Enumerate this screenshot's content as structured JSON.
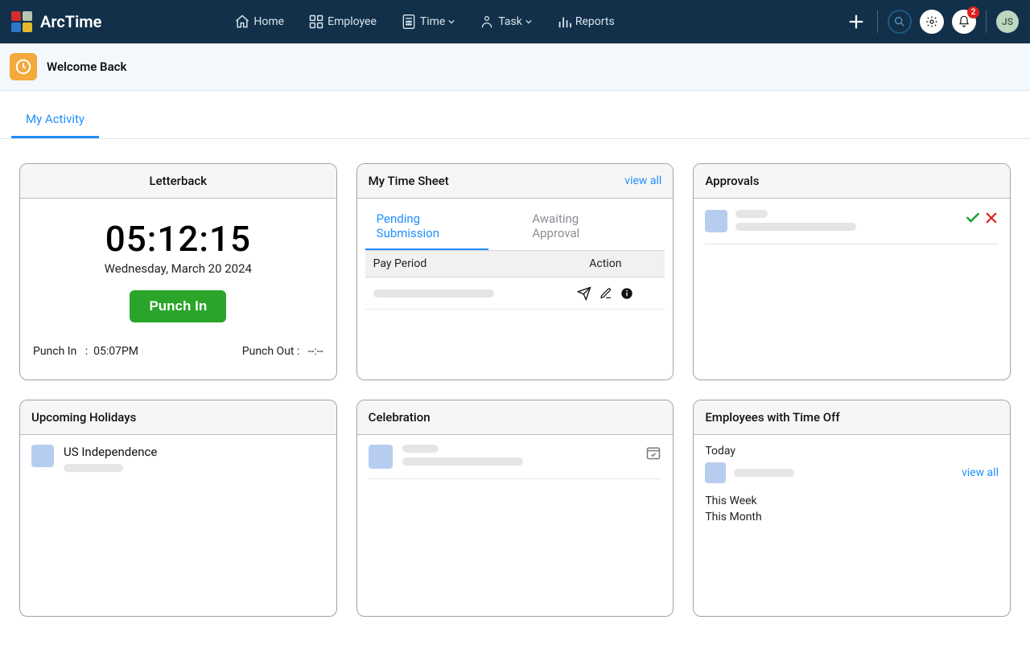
{
  "brand": {
    "name": "ArcTime"
  },
  "logo_colors": [
    "#d22c2c",
    "#b5c6b2",
    "#2d76c8",
    "#e2b92a"
  ],
  "nav": {
    "items": [
      {
        "label": "Home",
        "icon": "home"
      },
      {
        "label": "Employee",
        "icon": "grid"
      },
      {
        "label": "Time",
        "icon": "calculator",
        "chevron": true
      },
      {
        "label": "Task",
        "icon": "user-badge",
        "chevron": true
      },
      {
        "label": "Reports",
        "icon": "bar-chart"
      }
    ]
  },
  "notification_count": "2",
  "avatar_initials": "JS",
  "welcome": {
    "text": "Welcome Back"
  },
  "page_tabs": {
    "activity": "My Activity"
  },
  "cards": {
    "letterback": {
      "title": "Letterback",
      "time": "05:12:15",
      "date": "Wednesday, March 20 2024",
      "punch_button": "Punch In",
      "punch_in_label": "Punch In",
      "punch_in_value": "05:07PM",
      "punch_out_label": "Punch Out :",
      "punch_out_value": "--:--"
    },
    "timesheet": {
      "title": "My Time Sheet",
      "view_all": "view all",
      "tabs": {
        "pending": "Pending Submission",
        "awaiting": "Awaiting Approval"
      },
      "columns": {
        "period": "Pay Period",
        "action": "Action"
      }
    },
    "approvals": {
      "title": "Approvals"
    },
    "holidays": {
      "title": "Upcoming Holidays",
      "item": "US Independence"
    },
    "celebration": {
      "title": "Celebration"
    },
    "timeoff": {
      "title": "Employees with Time Off",
      "today": "Today",
      "this_week": "This Week",
      "this_month": "This Month",
      "view_all": "view all"
    }
  }
}
